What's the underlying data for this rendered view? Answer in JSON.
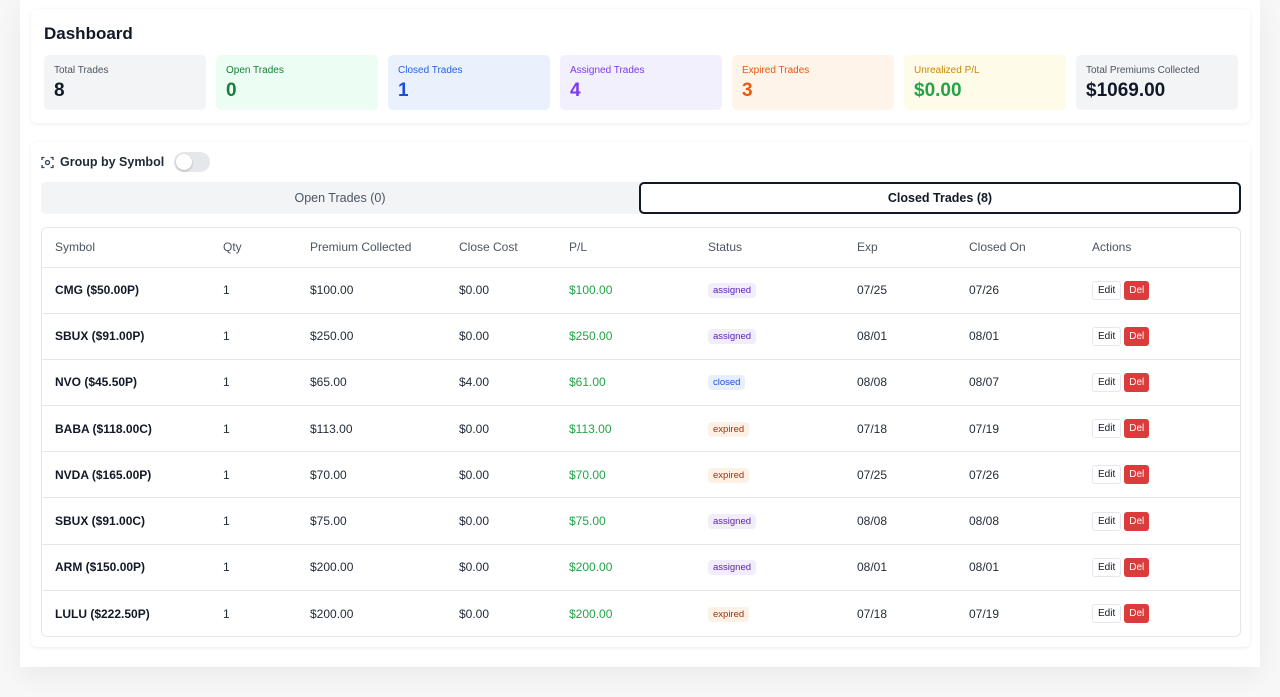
{
  "dashboard": {
    "title": "Dashboard",
    "stats": [
      {
        "label": "Total Trades",
        "value": "8"
      },
      {
        "label": "Open Trades",
        "value": "0"
      },
      {
        "label": "Closed Trades",
        "value": "1"
      },
      {
        "label": "Assigned Trades",
        "value": "4"
      },
      {
        "label": "Expired Trades",
        "value": "3"
      },
      {
        "label": "Unrealized P/L",
        "value": "$0.00"
      },
      {
        "label": "Total Premiums Collected",
        "value": "$1069.00"
      }
    ]
  },
  "group_toggle": {
    "label": "Group by Symbol",
    "on": false
  },
  "tabs": [
    {
      "label": "Open Trades (0)",
      "active": false
    },
    {
      "label": "Closed Trades (8)",
      "active": true
    }
  ],
  "table": {
    "headers": [
      "Symbol",
      "Qty",
      "Premium Collected",
      "Close Cost",
      "P/L",
      "Status",
      "Exp",
      "Closed On",
      "Actions"
    ],
    "edit_label": "Edit",
    "del_label": "Del",
    "rows": [
      {
        "symbol": "CMG ($50.00P)",
        "qty": "1",
        "premium": "$100.00",
        "close_cost": "$0.00",
        "pl": "$100.00",
        "status": "assigned",
        "exp": "07/25",
        "closed_on": "07/26"
      },
      {
        "symbol": "SBUX ($91.00P)",
        "qty": "1",
        "premium": "$250.00",
        "close_cost": "$0.00",
        "pl": "$250.00",
        "status": "assigned",
        "exp": "08/01",
        "closed_on": "08/01"
      },
      {
        "symbol": "NVO ($45.50P)",
        "qty": "1",
        "premium": "$65.00",
        "close_cost": "$4.00",
        "pl": "$61.00",
        "status": "closed",
        "exp": "08/08",
        "closed_on": "08/07"
      },
      {
        "symbol": "BABA ($118.00C)",
        "qty": "1",
        "premium": "$113.00",
        "close_cost": "$0.00",
        "pl": "$113.00",
        "status": "expired",
        "exp": "07/18",
        "closed_on": "07/19"
      },
      {
        "symbol": "NVDA ($165.00P)",
        "qty": "1",
        "premium": "$70.00",
        "close_cost": "$0.00",
        "pl": "$70.00",
        "status": "expired",
        "exp": "07/25",
        "closed_on": "07/26"
      },
      {
        "symbol": "SBUX ($91.00C)",
        "qty": "1",
        "premium": "$75.00",
        "close_cost": "$0.00",
        "pl": "$75.00",
        "status": "assigned",
        "exp": "08/08",
        "closed_on": "08/08"
      },
      {
        "symbol": "ARM ($150.00P)",
        "qty": "1",
        "premium": "$200.00",
        "close_cost": "$0.00",
        "pl": "$200.00",
        "status": "assigned",
        "exp": "08/01",
        "closed_on": "08/01"
      },
      {
        "symbol": "LULU ($222.50P)",
        "qty": "1",
        "premium": "$200.00",
        "close_cost": "$0.00",
        "pl": "$200.00",
        "status": "expired",
        "exp": "07/18",
        "closed_on": "07/19"
      }
    ]
  },
  "colors": {
    "profit_green": "#22a447",
    "delete_red": "#dc3b3b",
    "active_tab_border": "#111827"
  }
}
